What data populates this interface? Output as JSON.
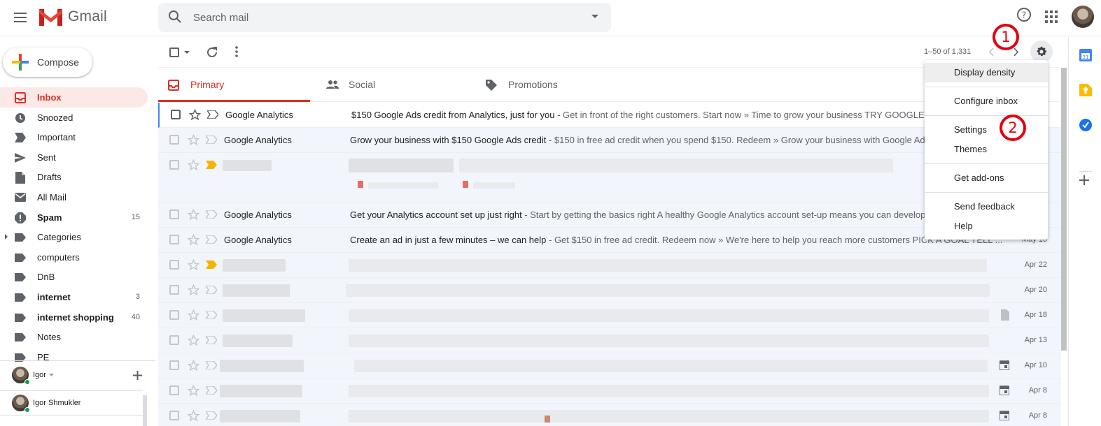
{
  "header": {
    "app_name": "Gmail",
    "search_placeholder": "Search mail"
  },
  "sidebar": {
    "compose_label": "Compose",
    "items": [
      {
        "label": "Inbox",
        "count": "",
        "icon": "inbox-icon",
        "active": true,
        "bold": true
      },
      {
        "label": "Snoozed",
        "count": "",
        "icon": "clock-icon"
      },
      {
        "label": "Important",
        "count": "",
        "icon": "label-important-icon"
      },
      {
        "label": "Sent",
        "count": "",
        "icon": "send-icon"
      },
      {
        "label": "Drafts",
        "count": "",
        "icon": "draft-icon"
      },
      {
        "label": "All Mail",
        "count": "",
        "icon": "mail-icon"
      },
      {
        "label": "Spam",
        "count": "15",
        "icon": "spam-icon",
        "bold": true
      },
      {
        "label": "Categories",
        "count": "",
        "icon": "label-icon",
        "caret": true
      },
      {
        "label": "computers",
        "count": "",
        "icon": "label-icon"
      },
      {
        "label": "DnB",
        "count": "",
        "icon": "label-icon"
      },
      {
        "label": "internet",
        "count": "3",
        "icon": "label-icon",
        "bold": true
      },
      {
        "label": "internet shopping",
        "count": "40",
        "icon": "label-icon",
        "bold": true
      },
      {
        "label": "Notes",
        "count": "",
        "icon": "label-icon"
      },
      {
        "label": "PE",
        "count": "",
        "icon": "label-icon"
      }
    ],
    "hangouts": {
      "user": "Igor",
      "contact": "Igor Shmukler"
    }
  },
  "toolbar": {
    "pager": "1–50 of 1,331"
  },
  "tabs": [
    {
      "label": "Primary",
      "icon": "inbox-icon",
      "active": true
    },
    {
      "label": "Social",
      "icon": "people-icon"
    },
    {
      "label": "Promotions",
      "icon": "tag-icon"
    }
  ],
  "emails": [
    {
      "sender": "Google Analytics",
      "subject": "$150 Google Ads credit from Analytics, just for you",
      "snippet": " - Get in front of the right customers. Start now » Time to grow your business TRY GOOGLE A",
      "date": "",
      "blurred": false
    },
    {
      "sender": "Google Analytics",
      "subject": "Grow your business with $150 Google Ads credit",
      "snippet": " - $150 in free ad credit when you spend $150. Redeem » Grow your business with Google Ads y",
      "date": "",
      "blurred": false
    },
    {
      "sender": "",
      "subject": "",
      "snippet": "",
      "date": "",
      "blurred": true,
      "tall": true
    },
    {
      "sender": "Google Analytics",
      "subject": "Get your Analytics account set up just right",
      "snippet": " - Start by getting the basics right A healthy Google Analytics account set-up means you can develop",
      "date": "",
      "blurred": false
    },
    {
      "sender": "Google Analytics",
      "subject": "Create an ad in just a few minutes – we can help",
      "snippet": " - Get $150 in free ad credit. Redeem now » We're here to help you reach more customers PICK A GOAL TELL ...",
      "date": "May 16",
      "blurred": false
    },
    {
      "sender": "",
      "subject": "",
      "snippet": "",
      "date": "Apr 22",
      "blurred": true
    },
    {
      "sender": "",
      "subject": "",
      "snippet": "",
      "date": "Apr 20",
      "blurred": true
    },
    {
      "sender": "",
      "subject": "",
      "snippet": "",
      "date": "Apr 18",
      "blurred": true
    },
    {
      "sender": "",
      "subject": "",
      "snippet": "",
      "date": "Apr 13",
      "blurred": true
    },
    {
      "sender": "",
      "subject": "",
      "snippet": "",
      "date": "Apr 10",
      "blurred": true
    },
    {
      "sender": "",
      "subject": "",
      "snippet": "",
      "date": "Apr 8",
      "blurred": true
    },
    {
      "sender": "",
      "subject": "",
      "snippet": "",
      "date": "Apr 8",
      "blurred": true
    }
  ],
  "settings_menu": {
    "items": [
      "Display density",
      "Configure inbox",
      "Settings",
      "Themes",
      "Get add-ons",
      "Send feedback",
      "Help"
    ]
  },
  "annotations": {
    "first": "1",
    "second": "2"
  },
  "colors": {
    "accent": "#d93025",
    "annotation": "#e4000f"
  }
}
